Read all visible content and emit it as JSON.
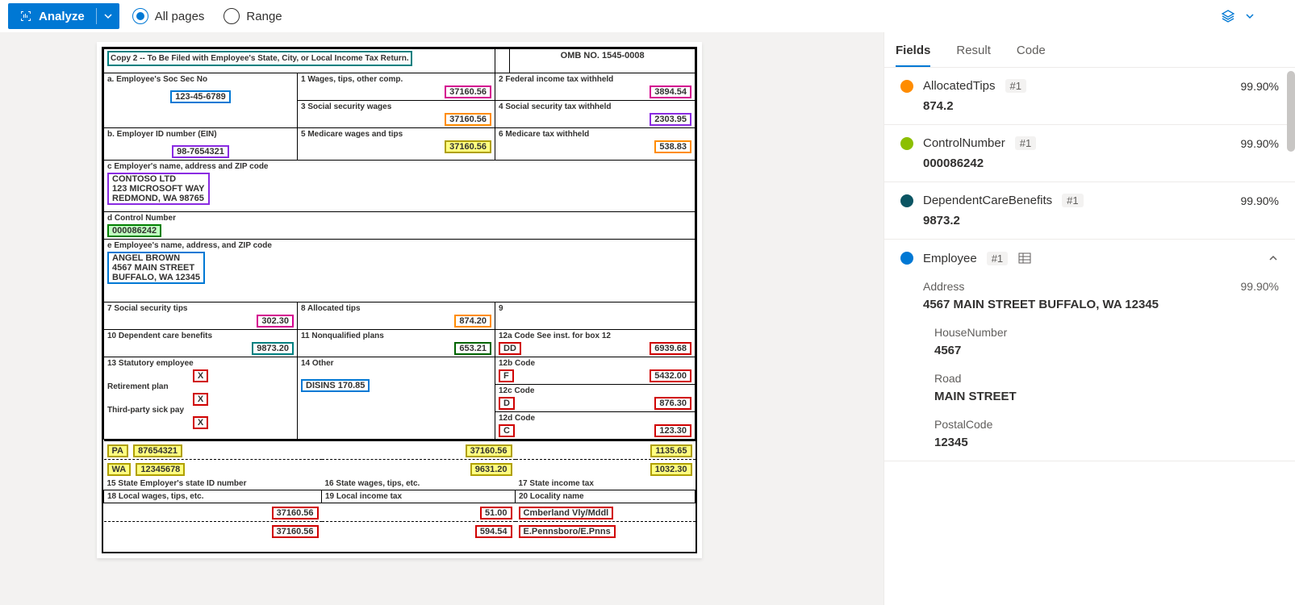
{
  "toolbar": {
    "analyze": "Analyze",
    "all_pages": "All pages",
    "range": "Range"
  },
  "tabs": {
    "fields": "Fields",
    "result": "Result",
    "code": "Code"
  },
  "doc": {
    "copy_note": "Copy 2 -- To Be Filed with Employee's State, City, or Local Income Tax Return.",
    "omb": "OMB NO. 1545-0008",
    "a_label": "a. Employee's Soc Sec No",
    "a_val": "123-45-6789",
    "b_label": "b. Employer ID number (EIN)",
    "b_val": "98-7654321",
    "box1_label": "1 Wages, tips, other comp.",
    "box1_val": "37160.56",
    "box2_label": "2 Federal income tax withheld",
    "box2_val": "3894.54",
    "box3_label": "3 Social security wages",
    "box3_val": "37160.56",
    "box4_label": "4 Social security tax withheld",
    "box4_val": "2303.95",
    "box5_label": "5 Medicare wages and tips",
    "box5_val": "37160.56",
    "box6_label": "6 Medicare tax withheld",
    "box6_val": "538.83",
    "c_label": "c Employer's name, address and ZIP code",
    "c_l1": "CONTOSO LTD",
    "c_l2": "123 MICROSOFT WAY",
    "c_l3": "REDMOND, WA 98765",
    "d_label": "d Control Number",
    "d_val": "000086242",
    "e_label": "e Employee's name, address, and ZIP code",
    "e_l1": "ANGEL BROWN",
    "e_l2": "4567 MAIN STREET",
    "e_l3": "BUFFALO, WA 12345",
    "box7_label": "7 Social security tips",
    "box7_val": "302.30",
    "box8_label": "8 Allocated tips",
    "box8_val": "874.20",
    "box9_label": "9",
    "box10_label": "10 Dependent care benefits",
    "box10_val": "9873.20",
    "box11_label": "11 Nonqualified plans",
    "box11_val": "653.21",
    "box12a_label": "12a Code See inst. for box 12",
    "box12a_code": "DD",
    "box12a_val": "6939.68",
    "box12b_label": "12b Code",
    "box12b_code": "F",
    "box12b_val": "5432.00",
    "box12c_label": "12c Code",
    "box12c_code": "D",
    "box12c_val": "876.30",
    "box12d_label": "12d Code",
    "box12d_code": "C",
    "box12d_val": "123.30",
    "box13_label": "13 Statutory employee",
    "box13_ret": "Retirement plan",
    "box13_sick": "Third-party sick pay",
    "box14_label": "14 Other",
    "box14_val": "DISINS    170.85",
    "box15_label": "15 State Employer's state ID number",
    "box16_label": "16 State wages, tips, etc.",
    "box17_label": "17 State income tax",
    "box18_label": "18 Local wages, tips, etc.",
    "box19_label": "19 Local income tax",
    "box20_label": "20 Locality name",
    "st1": "PA",
    "stid1": "87654321",
    "stw1": "37160.56",
    "stt1": "1135.65",
    "st2": "WA",
    "stid2": "12345678",
    "stw2": "9631.20",
    "stt2": "1032.30",
    "lw1": "37160.56",
    "lt1": "51.00",
    "loc1": "Cmberland Vly/Mddl",
    "lw2": "37160.56",
    "lt2": "594.54",
    "loc2": "E.Pennsboro/E.Pnns",
    "x": "X"
  },
  "fields": [
    {
      "name": "AllocatedTips",
      "badge": "#1",
      "conf": "99.90%",
      "value": "874.2",
      "color": "#ff8c00"
    },
    {
      "name": "ControlNumber",
      "badge": "#1",
      "conf": "99.90%",
      "value": "000086242",
      "color": "#8cbf00"
    },
    {
      "name": "DependentCareBenefits",
      "badge": "#1",
      "conf": "99.90%",
      "value": "9873.2",
      "color": "#0b5563"
    },
    {
      "name": "Employee",
      "badge": "#1",
      "conf": "",
      "value": "",
      "color": "#0078d4",
      "expandable": true,
      "subs": [
        {
          "label": "Address",
          "conf": "99.90%",
          "value": "4567 MAIN STREET BUFFALO, WA 12345"
        },
        {
          "label": "HouseNumber",
          "conf": "",
          "value": "4567"
        },
        {
          "label": "Road",
          "conf": "",
          "value": "MAIN STREET"
        },
        {
          "label": "PostalCode",
          "conf": "",
          "value": "12345"
        }
      ]
    }
  ]
}
